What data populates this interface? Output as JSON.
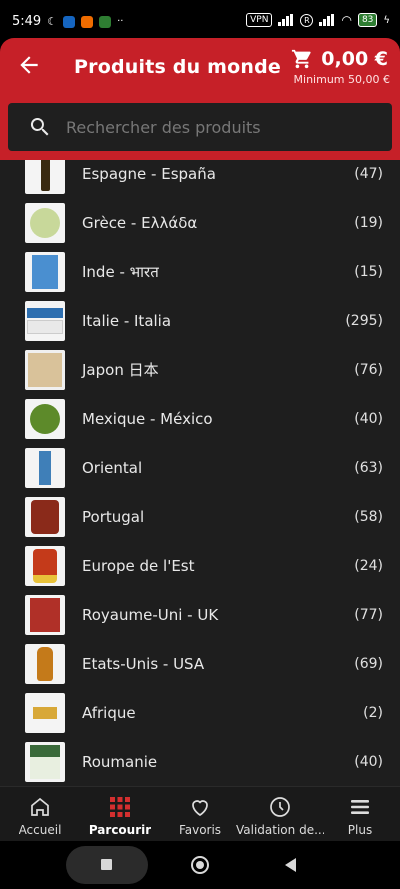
{
  "status_bar": {
    "time": "5:49",
    "vpn": "VPN",
    "r_badge": "R",
    "battery": "83"
  },
  "header": {
    "title": "Produits du monde",
    "cart_amount": "0,00 €",
    "minimum": "Minimum 50,00 €",
    "back_icon": "arrow-back-icon",
    "cart_icon": "shopping-cart-icon"
  },
  "search": {
    "placeholder": "Rechercher des produits",
    "value": ""
  },
  "categories": [
    {
      "label": "Espagne - España",
      "count": "(47)",
      "thumb": "#3a2a10"
    },
    {
      "label": "Grèce - Ελλάδα",
      "count": "(19)",
      "thumb": "#c8d89a"
    },
    {
      "label": "Inde - भारत",
      "count": "(15)",
      "thumb": "#4a8fd0"
    },
    {
      "label": "Italie - Italia",
      "count": "(295)",
      "thumb": "#2e6fb0"
    },
    {
      "label": "Japon 日本",
      "count": "(76)",
      "thumb": "#d9c29a"
    },
    {
      "label": "Mexique - México",
      "count": "(40)",
      "thumb": "#5d8a2a"
    },
    {
      "label": "Oriental",
      "count": "(63)",
      "thumb": "#3f7fb8"
    },
    {
      "label": "Portugal",
      "count": "(58)",
      "thumb": "#8a2a1a"
    },
    {
      "label": "Europe de l'Est",
      "count": "(24)",
      "thumb": "#c43a1a"
    },
    {
      "label": "Royaume-Uni - UK",
      "count": "(77)",
      "thumb": "#b03028"
    },
    {
      "label": "Etats-Unis - USA",
      "count": "(69)",
      "thumb": "#c47a1a"
    },
    {
      "label": "Afrique",
      "count": "(2)",
      "thumb": "#d8a838"
    },
    {
      "label": "Roumanie",
      "count": "(40)",
      "thumb": "#3a6a3a"
    }
  ],
  "bottom_nav": [
    {
      "label": "Accueil",
      "icon": "home-icon",
      "active": false
    },
    {
      "label": "Parcourir",
      "icon": "grid-icon",
      "active": true
    },
    {
      "label": "Favoris",
      "icon": "heart-icon",
      "active": false
    },
    {
      "label": "Validation de...",
      "icon": "clock-icon",
      "active": false
    },
    {
      "label": "Plus",
      "icon": "menu-icon",
      "active": false
    }
  ],
  "colors": {
    "brand_red": "#c62028",
    "list_background": "#1e1e1e",
    "active_icon": "#d32f2f"
  }
}
